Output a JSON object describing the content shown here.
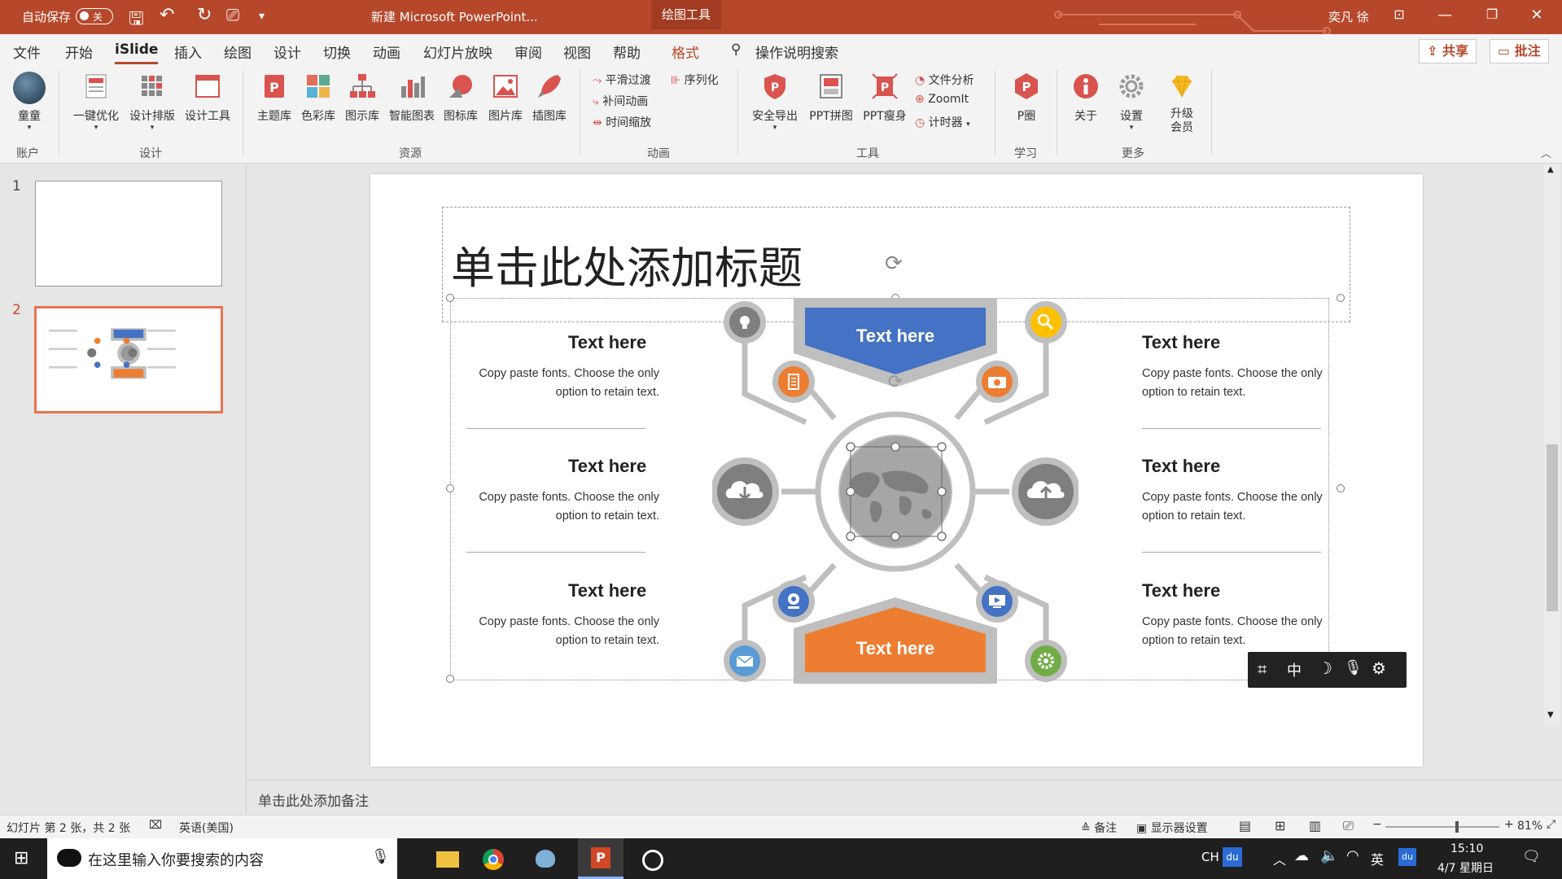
{
  "titlebar": {
    "autosave_label": "自动保存",
    "autosave_state": "关",
    "doc_title": "新建 Microsoft PowerPoint...",
    "context_tab": "绘图工具",
    "user_name": "奕凡 徐"
  },
  "menu": [
    "文件",
    "开始",
    "iSlide",
    "插入",
    "绘图",
    "设计",
    "切换",
    "动画",
    "幻灯片放映",
    "审阅",
    "视图",
    "帮助",
    "格式"
  ],
  "menu_search": "操作说明搜索",
  "share_label": "共享",
  "comment_label": "批注",
  "ribbon": {
    "account": {
      "btn": "童童",
      "group": "账户"
    },
    "design": {
      "btns": [
        "一键优化",
        "设计排版",
        "设计工具"
      ],
      "group": "设计"
    },
    "resources": {
      "btns": [
        "主题库",
        "色彩库",
        "图示库",
        "智能图表",
        "图标库",
        "图片库",
        "插图库"
      ],
      "group": "资源"
    },
    "animation": {
      "items": [
        "平滑过渡",
        "补间动画",
        "时间缩放",
        "序列化"
      ],
      "group": "动画"
    },
    "tools": {
      "btns": [
        "安全导出",
        "PPT拼图",
        "PPT瘦身"
      ],
      "items": [
        "文件分析",
        "ZoomIt",
        "计时器"
      ],
      "group": "工具"
    },
    "learn": {
      "btn": "P圈",
      "group": "学习"
    },
    "more": {
      "btns": [
        "关于",
        "设置",
        "升级会员"
      ],
      "group": "更多"
    }
  },
  "thumbnails": [
    {
      "num": "1"
    },
    {
      "num": "2"
    }
  ],
  "slide": {
    "title_placeholder": "单击此处添加标题",
    "top_shield": "Text here",
    "bottom_shield": "Text here",
    "items_left": [
      {
        "title": "Text here",
        "body": "Copy paste fonts. Choose the only option to retain text."
      },
      {
        "title": "Text here",
        "body": "Copy paste fonts. Choose the only option to retain text."
      },
      {
        "title": "Text here",
        "body": "Copy paste fonts. Choose the only option to retain text."
      }
    ],
    "items_right": [
      {
        "title": "Text here",
        "body": "Copy paste fonts. Choose the only option to retain text."
      },
      {
        "title": "Text here",
        "body": "Copy paste fonts. Choose the only option to retain text."
      },
      {
        "title": "Text here",
        "body": "Copy paste fonts. Choose the only option to retain text."
      }
    ],
    "colors": {
      "blue": "#4472c4",
      "orange": "#ed7d31",
      "yellow": "#ffc000",
      "green": "#70ad47",
      "gray": "#7f7f7f",
      "lightgray": "#bfbfbf"
    }
  },
  "float_toolbar": [
    "crop-icon",
    "zhong-label",
    "moon-icon",
    "mic-icon",
    "gear-icon"
  ],
  "float_label": "中",
  "notes_placeholder": "单击此处添加备注",
  "status": {
    "slide_info": "幻灯片 第 2 张，共 2 张",
    "language": "英语(美国)",
    "notes_btn": "备注",
    "display_btn": "显示器设置",
    "zoom": "81%"
  },
  "taskbar": {
    "search_placeholder": "在这里输入你要搜索的内容",
    "ime": "CH",
    "ime2": "英",
    "time": "15:10",
    "date": "4/7 星期日"
  }
}
